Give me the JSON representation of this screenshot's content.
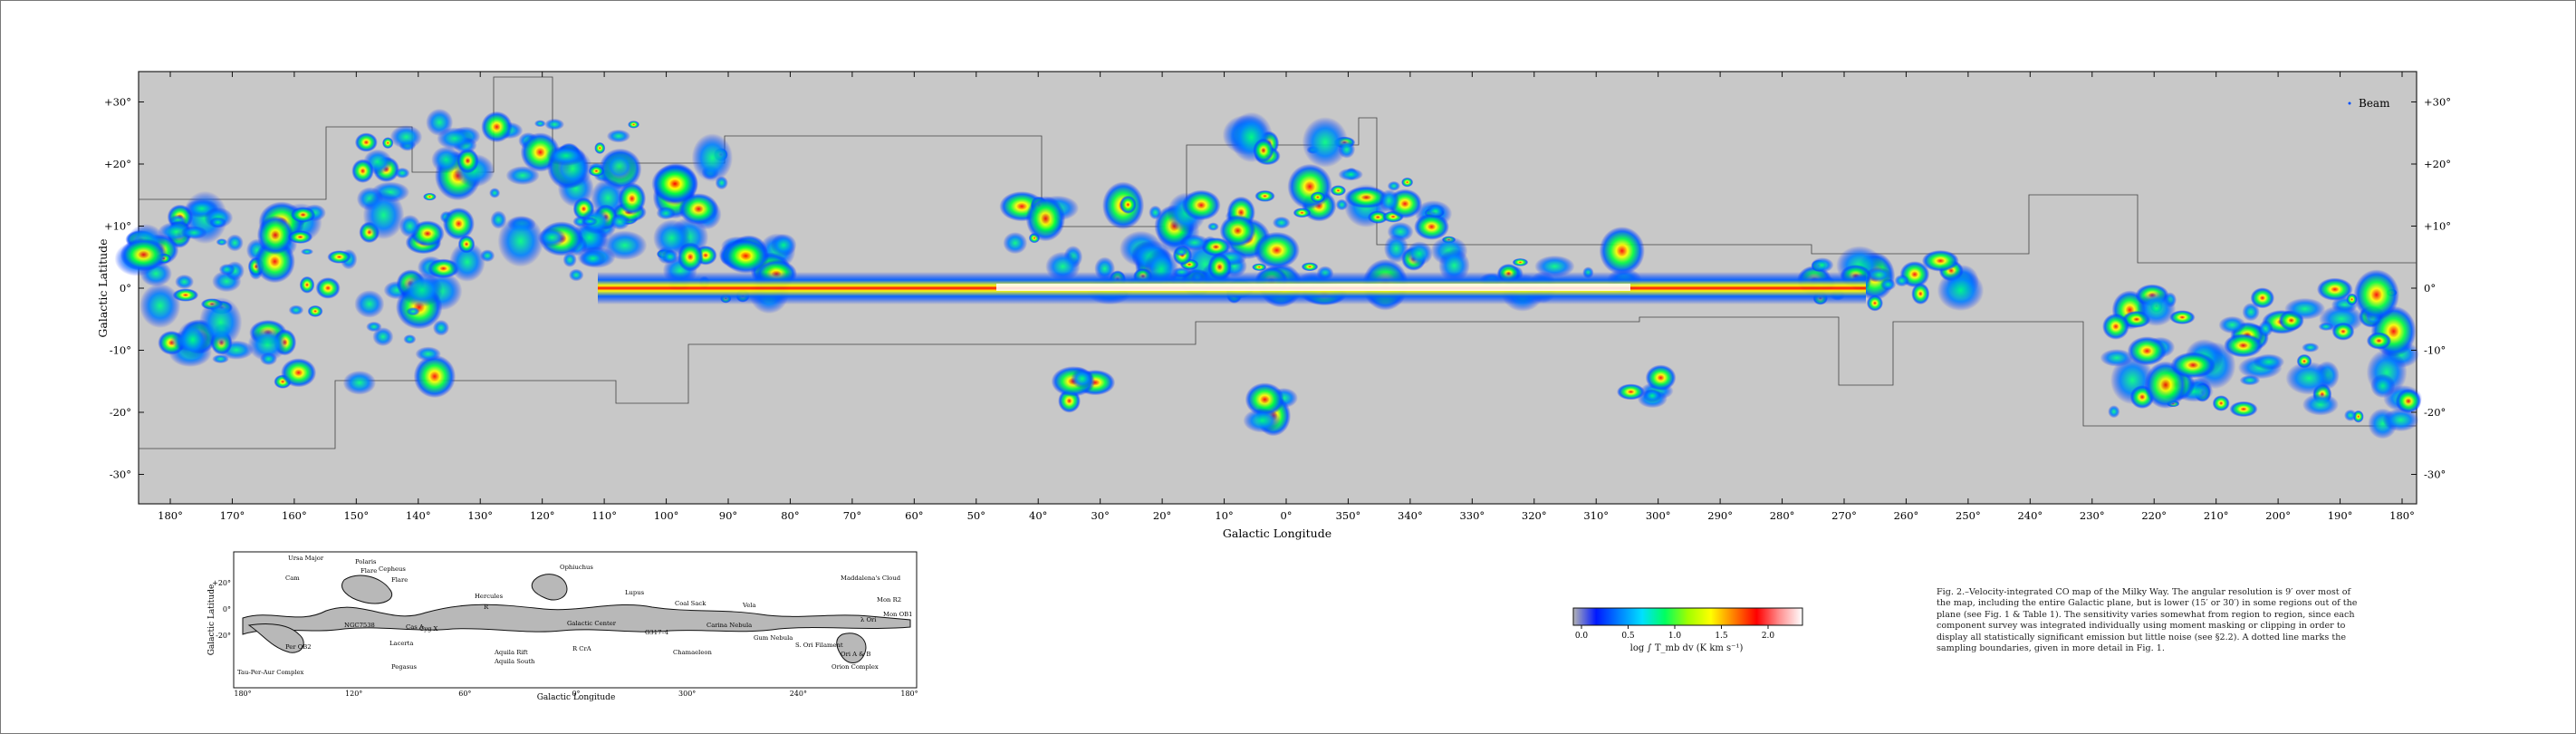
{
  "main_map": {
    "y_axis_label": "Galactic Latitude",
    "x_axis_label": "Galactic Longitude",
    "beam_label": "Beam",
    "lat_ticks": [
      "+30°",
      "+20°",
      "+10°",
      "0°",
      "-10°",
      "-20°",
      "-30°"
    ],
    "lon_ticks": [
      "180°",
      "170°",
      "160°",
      "150°",
      "140°",
      "130°",
      "120°",
      "110°",
      "100°",
      "90°",
      "80°",
      "70°",
      "60°",
      "50°",
      "40°",
      "30°",
      "20°",
      "10°",
      "0°",
      "350°",
      "340°",
      "330°",
      "320°",
      "310°",
      "300°",
      "290°",
      "280°",
      "270°",
      "260°",
      "250°",
      "240°",
      "230°",
      "220°",
      "210°",
      "200°",
      "190°",
      "180°"
    ],
    "colors": {
      "background": "#c8c8c8",
      "low": "#0000ff",
      "mid": "#00ff00",
      "high": "#ff0000",
      "peak": "#ffffff"
    }
  },
  "inset_map": {
    "y_axis_label": "Galactic Latitude",
    "x_axis_label": "Galactic Longitude",
    "lat_ticks": [
      "+20°",
      "0°",
      "-20°"
    ],
    "lon_ticks": [
      "180°",
      "120°",
      "60°",
      "0°",
      "300°",
      "240°",
      "180°"
    ],
    "labels": [
      {
        "text": "Ursa Major"
      },
      {
        "text": "Polaris"
      },
      {
        "text": "Flare"
      },
      {
        "text": "Cepheus"
      },
      {
        "text": "Cam"
      },
      {
        "text": "Flare"
      },
      {
        "text": "NGC7538"
      },
      {
        "text": "Cas A"
      },
      {
        "text": "Cyg X"
      },
      {
        "text": "Lacerta"
      },
      {
        "text": "Pegasus"
      },
      {
        "text": "Per OB2"
      },
      {
        "text": "Tau-Per-Aur Complex"
      },
      {
        "text": "Hercules"
      },
      {
        "text": "R"
      },
      {
        "text": "Aquila Rift"
      },
      {
        "text": "Ophiuchus"
      },
      {
        "text": "Lupus"
      },
      {
        "text": "Galactic Center"
      },
      {
        "text": "Aquila South"
      },
      {
        "text": "R CrA"
      },
      {
        "text": "Coal Sack"
      },
      {
        "text": "G317–4"
      },
      {
        "text": "Chamaeleon"
      },
      {
        "text": "Carina Nebula"
      },
      {
        "text": "Gum Nebula"
      },
      {
        "text": "S. Ori Filament"
      },
      {
        "text": "Maddalena's Cloud"
      },
      {
        "text": "Mon R2"
      },
      {
        "text": "Ori A & B"
      },
      {
        "text": "Orion Complex"
      },
      {
        "text": "Vela"
      },
      {
        "text": "λ Ori"
      },
      {
        "text": "Mon OB1"
      }
    ]
  },
  "colorbar": {
    "ticks": [
      "0.0",
      "0.5",
      "1.0",
      "1.5",
      "2.0"
    ],
    "label": "log ∫ T_mb dv  (K km s⁻¹)",
    "stops": [
      "#b4b4b4",
      "#0018ff",
      "#0080ff",
      "#00e0ff",
      "#00ff60",
      "#a0ff00",
      "#ffff00",
      "#ff8000",
      "#ff0000",
      "#ff9090",
      "#ffffff"
    ]
  },
  "caption": {
    "text": "Fig. 2.–Velocity-integrated CO map of the Milky Way. The angular resolution is 9′ over most of the map, including the entire Galactic plane, but is lower (15′ or 30′) in some regions out of the plane (see Fig. 1 & Table 1). The sensitivity varies somewhat from region to region, since each component survey was integrated individually using moment masking or clipping in order to display all statistically significant emission but little noise (see §2.2). A dotted line marks the sampling boundaries, given in more detail in Fig. 1."
  }
}
